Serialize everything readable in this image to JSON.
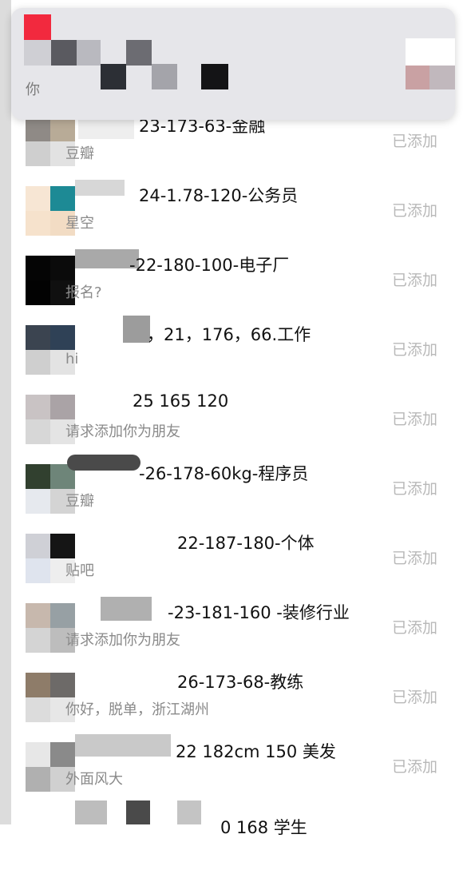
{
  "banner": {
    "partial_text": "你"
  },
  "rows": [
    {
      "name": "23-173-63-金融",
      "message": "豆瓣",
      "status": "已添加"
    },
    {
      "name": "24-1.78-120-公务员",
      "message": "星空",
      "status": "已添加"
    },
    {
      "name": "-22-180-100-电子厂",
      "message": "报名?",
      "status": "已添加"
    },
    {
      "name": "，21，176，66.工作",
      "message": "hi",
      "status": "已添加"
    },
    {
      "name": "25 165 120",
      "message": "请求添加你为朋友",
      "status": "已添加"
    },
    {
      "name": "-26-178-60kg-程序员",
      "message": "豆瓣",
      "status": "已添加"
    },
    {
      "name": "22-187-180-个体",
      "message": "贴吧",
      "status": "已添加"
    },
    {
      "name": "-23-181-160 -装修行业",
      "message": "请求添加你为朋友",
      "status": "已添加"
    },
    {
      "name": "26-173-68-教练",
      "message": "你好，脱单，浙江湖州",
      "status": "已添加"
    },
    {
      "name": "22 182cm 150 美发",
      "message": "外面风大",
      "status": "已添加"
    },
    {
      "name": "0 168 学生",
      "message": "",
      "status": ""
    }
  ]
}
